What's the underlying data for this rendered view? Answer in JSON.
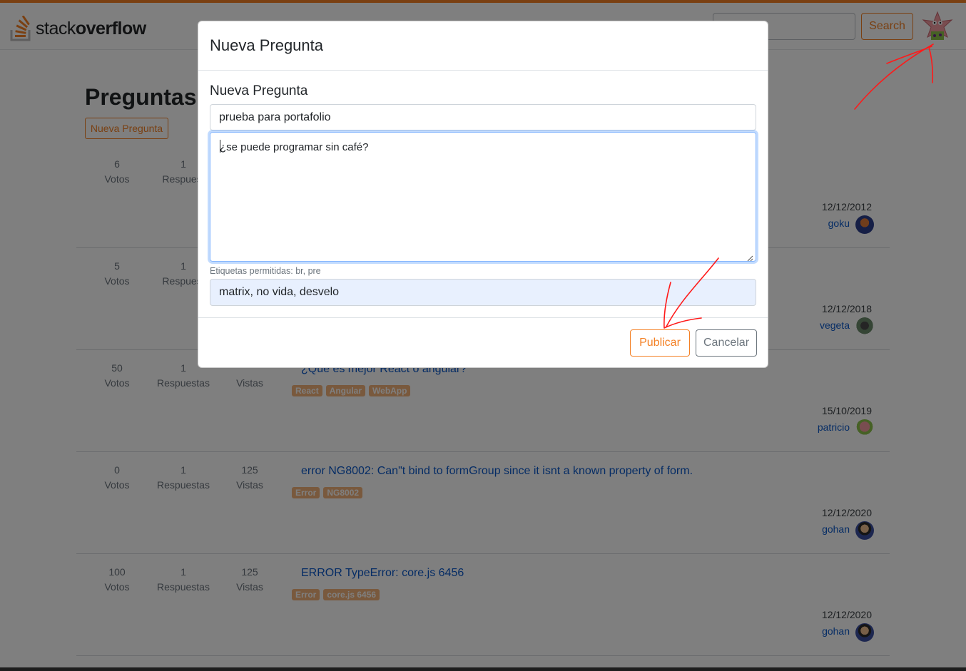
{
  "header": {
    "logo_light": "stack",
    "logo_bold": "overflow",
    "search_placeholder": "",
    "search_button": "Search",
    "avatar_icon": "patrick-avatar-icon"
  },
  "page": {
    "title": "Preguntas T",
    "new_question_button": "Nueva Pregunta"
  },
  "questions": [
    {
      "votes": "6",
      "votes_label": "Votos",
      "answers": "1",
      "answers_label": "Respuest",
      "views": "",
      "views_label": "",
      "title": "",
      "tags": [],
      "date": "12/12/2012",
      "user": "goku"
    },
    {
      "votes": "5",
      "votes_label": "Votos",
      "answers": "1",
      "answers_label": "Respuest",
      "views": "",
      "views_label": "",
      "title": "",
      "tags": [],
      "date": "12/12/2018",
      "user": "vegeta"
    },
    {
      "votes": "50",
      "votes_label": "Votos",
      "answers": "1",
      "answers_label": "Respuestas",
      "views": "",
      "views_label": "Vistas",
      "title": "¿Que es mejor React o angular?",
      "tags": [
        "React",
        "Angular",
        "WebApp"
      ],
      "date": "15/10/2019",
      "user": "patricio"
    },
    {
      "votes": "0",
      "votes_label": "Votos",
      "answers": "1",
      "answers_label": "Respuestas",
      "views": "125",
      "views_label": "Vistas",
      "title": "error NG8002: Can\"t bind to formGroup since it isnt a known property of form.",
      "tags": [
        "Error",
        "NG8002"
      ],
      "date": "12/12/2020",
      "user": "gohan"
    },
    {
      "votes": "100",
      "votes_label": "Votos",
      "answers": "1",
      "answers_label": "Respuestas",
      "views": "125",
      "views_label": "Vistas",
      "title": "ERROR TypeError: core.js 6456",
      "tags": [
        "Error",
        "core.js 6456"
      ],
      "date": "12/12/2020",
      "user": "gohan"
    }
  ],
  "modal": {
    "title": "Nueva Pregunta",
    "section_label": "Nueva Pregunta",
    "title_value": "prueba para portafolio",
    "body_value": "¿se puede programar sin café?",
    "help_text": "Etiquetas permitidas: br, pre",
    "tags_value": "matrix, no vida, desvelo",
    "publish_button": "Publicar",
    "cancel_button": "Cancelar"
  },
  "colors": {
    "accent": "#f48024",
    "link": "#0a58ca",
    "tag_bg": "#f2b27a",
    "annotation": "#ff1a1a"
  }
}
